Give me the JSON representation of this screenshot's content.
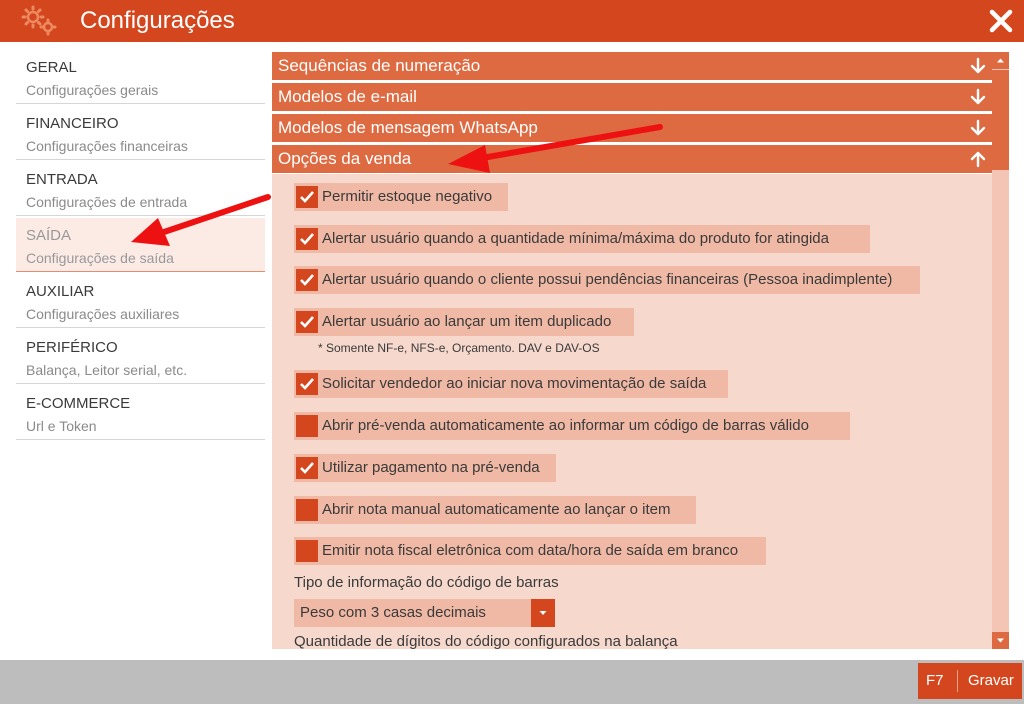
{
  "window": {
    "title": "Configurações"
  },
  "sidebar": {
    "items": [
      {
        "title": "GERAL",
        "subtitle": "Configurações gerais"
      },
      {
        "title": "FINANCEIRO",
        "subtitle": "Configurações financeiras"
      },
      {
        "title": "ENTRADA",
        "subtitle": "Configurações de entrada"
      },
      {
        "title": "SAÍDA",
        "subtitle": "Configurações de saída"
      },
      {
        "title": "AUXILIAR",
        "subtitle": "Configurações auxiliares"
      },
      {
        "title": "PERIFÉRICO",
        "subtitle": "Balança, Leitor serial, etc."
      },
      {
        "title": "E-COMMERCE",
        "subtitle": "Url e Token"
      }
    ]
  },
  "panels": [
    {
      "label": "Sequências de numeração",
      "expanded": false,
      "icon": "arrow-down-icon"
    },
    {
      "label": "Modelos de e-mail",
      "expanded": false,
      "icon": "arrow-down-icon"
    },
    {
      "label": "Modelos de mensagem WhatsApp",
      "expanded": false,
      "icon": "arrow-down-icon"
    },
    {
      "label": "Opções da venda",
      "expanded": true,
      "icon": "arrow-up-icon"
    }
  ],
  "options": [
    {
      "label": "Permitir estoque negativo",
      "checked": true
    },
    {
      "label": "Alertar usuário quando a quantidade mínima/máxima do produto for atingida",
      "checked": true
    },
    {
      "label": "Alertar usuário quando o cliente possui pendências financeiras (Pessoa inadimplente)",
      "checked": true
    },
    {
      "label": "Alertar usuário ao lançar um item duplicado",
      "checked": true
    },
    {
      "label": "Solicitar vendedor ao iniciar nova movimentação de saída",
      "checked": true
    },
    {
      "label": "Abrir pré-venda automaticamente ao informar um código de barras válido",
      "checked": false
    },
    {
      "label": "Utilizar pagamento na pré-venda",
      "checked": true
    },
    {
      "label": "Abrir nota manual automaticamente ao lançar o item",
      "checked": false
    },
    {
      "label": "Emitir nota fiscal eletrônica com data/hora de saída em branco",
      "checked": false
    }
  ],
  "note": "* Somente NF-e, NFS-e, Orçamento. DAV e DAV-OS",
  "barcode_type": {
    "label": "Tipo de informação do código de barras",
    "value": "Peso com 3 casas decimais"
  },
  "digits_label": "Quantidade de dígitos do código configurados na balança",
  "footer": {
    "save_key": "F7",
    "save_label": "Gravar"
  },
  "colors": {
    "accent": "#d4471e",
    "panel_header": "#de6a42",
    "panel_body": "#f6d8cd",
    "option_bg": "#f0b9a5",
    "annotation": "#ee1111"
  }
}
